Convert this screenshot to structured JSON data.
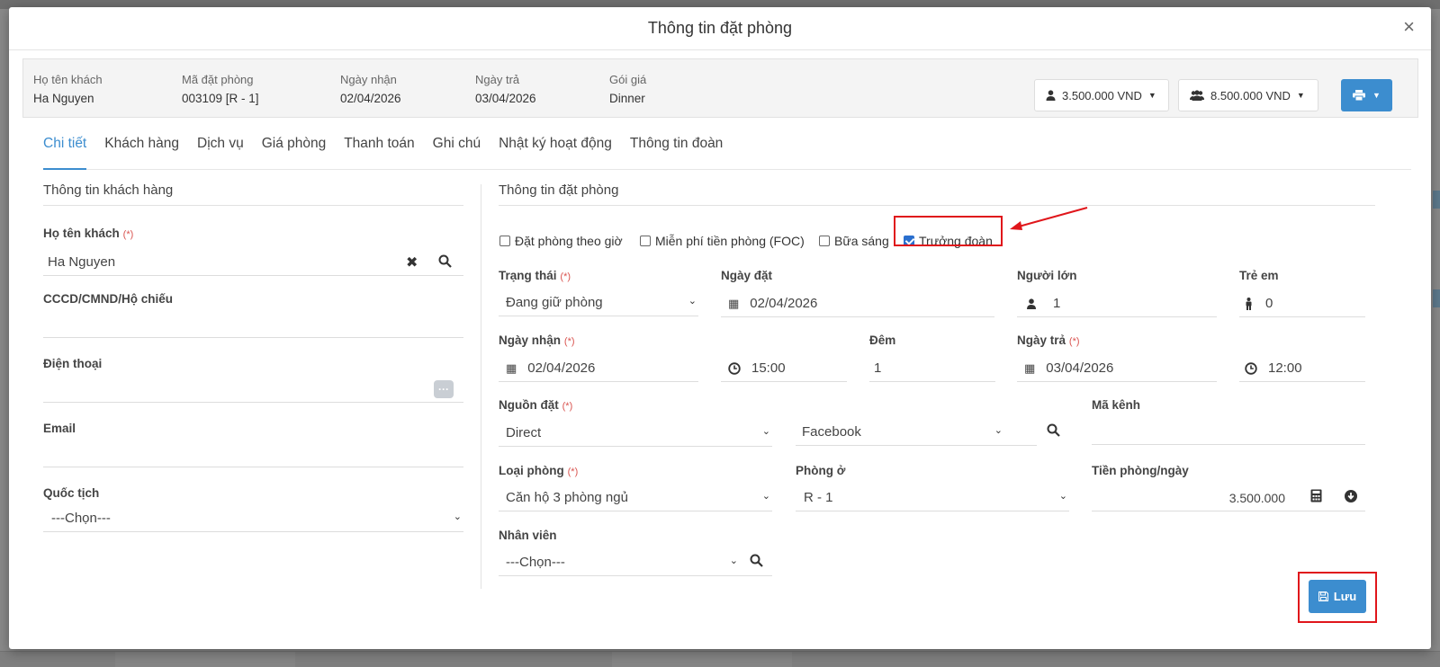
{
  "modal": {
    "title": "Thông tin đặt phòng",
    "close": "×"
  },
  "summary": {
    "guest_label": "Họ tên khách",
    "guest_value": "Ha Nguyen",
    "code_label": "Mã đặt phòng",
    "code_value": "003109 [R - 1]",
    "checkin_label": "Ngày nhận",
    "checkin_value": "02/04/2026",
    "checkout_label": "Ngày trả",
    "checkout_value": "03/04/2026",
    "rate_label": "Gói giá",
    "rate_value": "Dinner",
    "room_amount": "3.500.000 VND",
    "group_amount": "8.500.000 VND"
  },
  "tabs": [
    "Chi tiết",
    "Khách hàng",
    "Dịch vụ",
    "Giá phòng",
    "Thanh toán",
    "Ghi chú",
    "Nhật ký hoạt động",
    "Thông tin đoàn"
  ],
  "required_mark": "(*)",
  "left": {
    "section_title": "Thông tin khách hàng",
    "name_label": "Họ tên khách",
    "name_value": "Ha Nguyen",
    "id_label": "CCCD/CMND/Hộ chiếu",
    "id_value": "",
    "phone_label": "Điện thoại",
    "phone_value": "",
    "email_label": "Email",
    "email_value": "",
    "nationality_label": "Quốc tịch",
    "nationality_value": "---Chọn---"
  },
  "right": {
    "section_title": "Thông tin đặt phòng",
    "checkboxes": [
      {
        "label": "Đặt phòng theo giờ",
        "checked": false
      },
      {
        "label": "Miễn phí tiền phòng (FOC)",
        "checked": false
      },
      {
        "label": "Bữa sáng",
        "checked": false
      },
      {
        "label": "Trưởng đoàn",
        "checked": true
      }
    ],
    "status_label": "Trạng thái",
    "status_value": "Đang giữ phòng",
    "booking_date_label": "Ngày đặt",
    "booking_date_value": "02/04/2026",
    "adults_label": "Người lớn",
    "adults_value": "1",
    "children_label": "Trẻ em",
    "children_value": "0",
    "checkin_label": "Ngày nhận",
    "checkin_date": "02/04/2026",
    "checkin_time": "15:00",
    "nights_label": "Đêm",
    "nights_value": "1",
    "checkout_label": "Ngày trả",
    "checkout_date": "03/04/2026",
    "checkout_time": "12:00",
    "source_label": "Nguồn đặt",
    "source_value": "Direct",
    "source_sub_value": "Facebook",
    "channel_label": "Mã kênh",
    "channel_value": "",
    "room_type_label": "Loại phòng",
    "room_type_value": "Căn hộ 3 phòng ngủ",
    "room_label": "Phòng ở",
    "room_value": "R - 1",
    "price_label": "Tiền phòng/ngày",
    "price_value": "3.500.000",
    "staff_label": "Nhân viên",
    "staff_value": "---Chọn---"
  },
  "save_label": "Lưu",
  "colors": {
    "primary": "#3c8dcf",
    "highlight": "#e0161b",
    "required": "#d9534f"
  }
}
